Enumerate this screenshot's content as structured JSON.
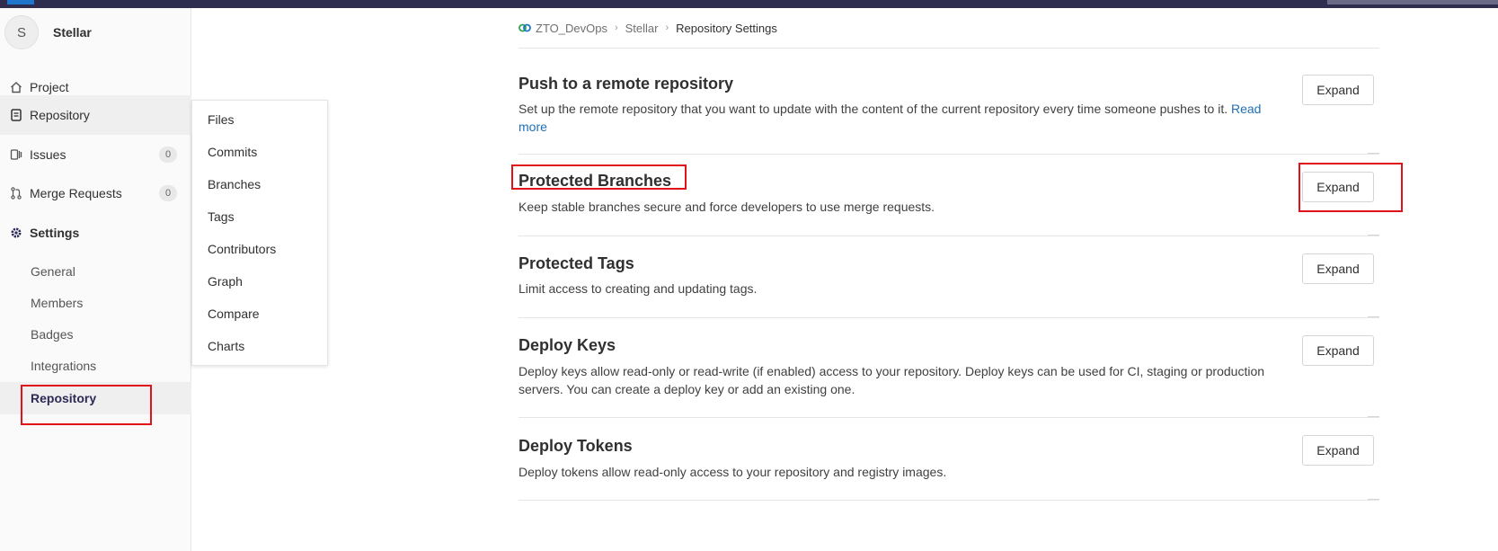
{
  "sidebar": {
    "avatar_letter": "S",
    "project_name": "Stellar",
    "items": [
      {
        "label": "Project",
        "icon": "home-icon"
      },
      {
        "label": "Repository",
        "icon": "document-icon"
      },
      {
        "label": "Issues",
        "icon": "issues-icon",
        "count": "0"
      },
      {
        "label": "Merge Requests",
        "icon": "merge-request-icon",
        "count": "0"
      },
      {
        "label": "Settings",
        "icon": "gear-icon"
      }
    ],
    "settings_sub": [
      "General",
      "Members",
      "Badges",
      "Integrations",
      "Repository"
    ]
  },
  "flyout": {
    "items": [
      "Files",
      "Commits",
      "Branches",
      "Tags",
      "Contributors",
      "Graph",
      "Compare",
      "Charts"
    ]
  },
  "breadcrumb": {
    "group": "ZTO_DevOps",
    "project": "Stellar",
    "current": "Repository Settings"
  },
  "sections": [
    {
      "title": "Push to a remote repository",
      "description": "Set up the remote repository that you want to update with the content of the current repository every time someone pushes to it.",
      "link": "Read more",
      "button": "Expand"
    },
    {
      "title": "Protected Branches",
      "description": "Keep stable branches secure and force developers to use merge requests.",
      "button": "Expand"
    },
    {
      "title": "Protected Tags",
      "description": "Limit access to creating and updating tags.",
      "button": "Expand"
    },
    {
      "title": "Deploy Keys",
      "description": "Deploy keys allow read-only or read-write (if enabled) access to your repository. Deploy keys can be used for CI, staging or production servers. You can create a deploy key or add an existing one.",
      "button": "Expand"
    },
    {
      "title": "Deploy Tokens",
      "description": "Deploy tokens allow read-only access to your repository and registry images.",
      "button": "Expand"
    }
  ],
  "colors": {
    "highlight": "#e0131b",
    "link": "#1f6fb8",
    "active_text": "#2d2a56"
  }
}
